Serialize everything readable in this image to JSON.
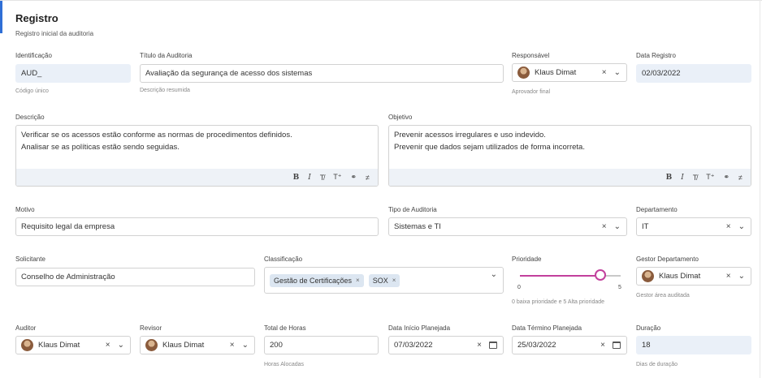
{
  "section": {
    "title": "Registro",
    "subtitle": "Registro inicial da auditoria"
  },
  "fields": {
    "identificacao": {
      "label": "Identificação",
      "value": "AUD_",
      "hint": "Código único"
    },
    "titulo": {
      "label": "Título da Auditoria",
      "value": "Avaliação da segurança de acesso dos sistemas",
      "hint": "Descrição resumida"
    },
    "responsavel": {
      "label": "Responsável",
      "value": "Klaus Dimat",
      "hint": "Aprovador final"
    },
    "data_registro": {
      "label": "Data Registro",
      "value": "02/03/2022"
    },
    "descricao": {
      "label": "Descrição",
      "lines": [
        "Verificar se os acessos estão conforme as normas de procedimentos definidos.",
        "Analisar se as políticas estão sendo seguidas."
      ]
    },
    "objetivo": {
      "label": "Objetivo",
      "lines": [
        "Prevenir acessos irregulares e uso indevido.",
        "Prevenir que dados sejam utilizados de forma incorreta."
      ]
    },
    "motivo": {
      "label": "Motivo",
      "value": "Requisito legal da empresa"
    },
    "tipo": {
      "label": "Tipo de Auditoria",
      "value": "Sistemas e TI"
    },
    "departamento": {
      "label": "Departamento",
      "value": "IT"
    },
    "solicitante": {
      "label": "Solicitante",
      "value": "Conselho de Administração"
    },
    "classificacao": {
      "label": "Classificação",
      "tags": [
        "Gestão de Certificações",
        "SOX"
      ]
    },
    "prioridade": {
      "label": "Prioridade",
      "value": 4,
      "min": 0,
      "max": 5,
      "min_label": "0",
      "max_label": "5",
      "hint": "0 baixa prioridade e 5 Alta prioridade",
      "color": "#c2409c"
    },
    "gestor": {
      "label": "Gestor Departamento",
      "value": "Klaus Dimat",
      "hint": "Gestor área auditada"
    },
    "auditor": {
      "label": "Auditor",
      "value": "Klaus Dimat"
    },
    "revisor": {
      "label": "Revisor",
      "value": "Klaus Dimat"
    },
    "total_horas": {
      "label": "Total de Horas",
      "value": "200",
      "hint": "Horas Alocadas"
    },
    "inicio": {
      "label": "Data Início Planejada",
      "value": "07/03/2022"
    },
    "termino": {
      "label": "Data Término Planejada",
      "value": "25/03/2022"
    },
    "duracao": {
      "label": "Duração",
      "value": "18",
      "hint": "Dias de duração"
    }
  },
  "toolbar": {
    "bold": "B",
    "italic": "I",
    "clear_format": "T̸",
    "superscript": "T⁺",
    "link": "⚭",
    "strike": "≠"
  },
  "glyphs": {
    "clear": "×",
    "caret": "⌵"
  },
  "colors": {
    "accent": "#2f6fd6",
    "readonly_bg": "#eaf0f8",
    "slider": "#c2409c"
  }
}
